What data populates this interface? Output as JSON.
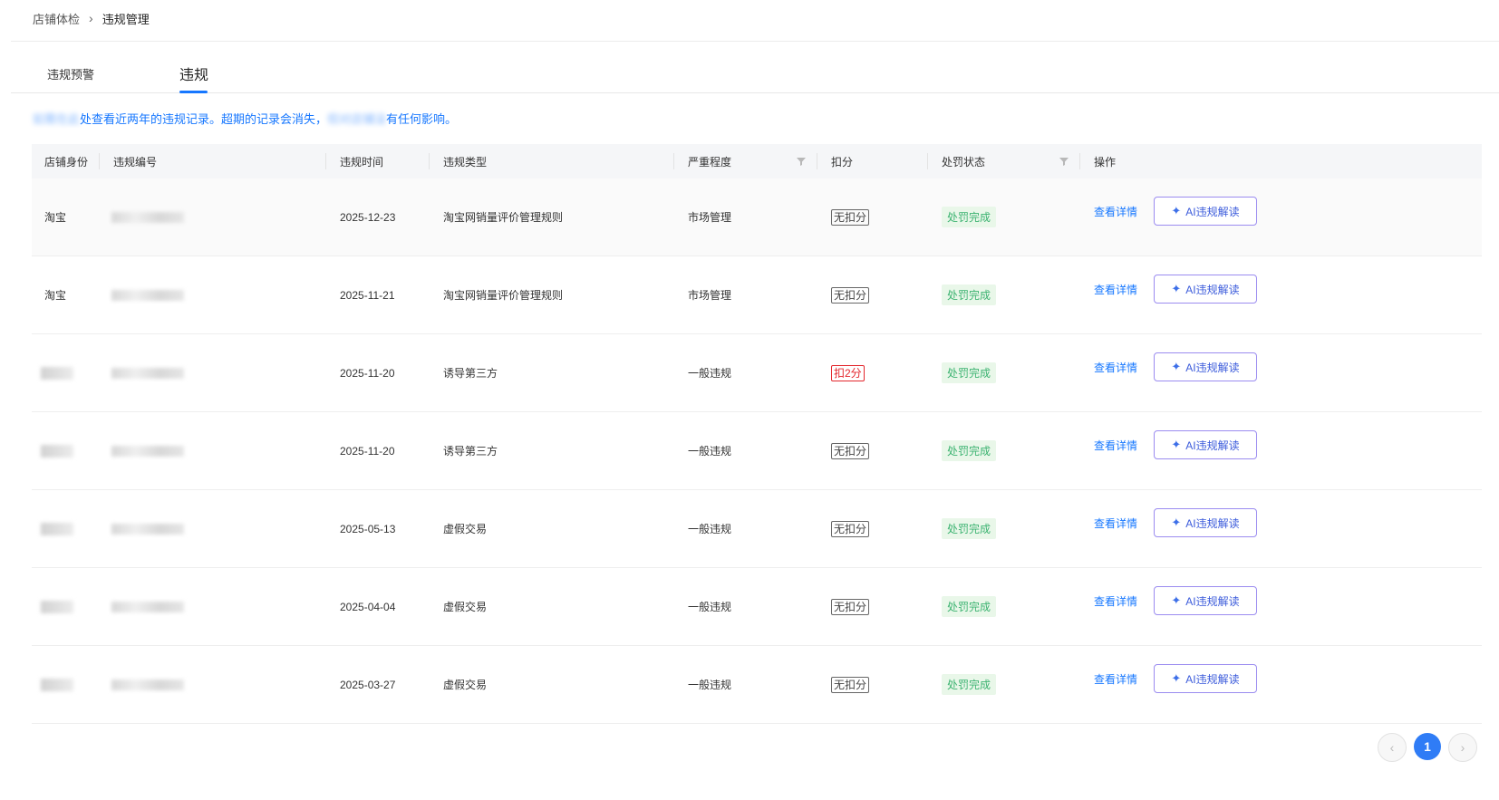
{
  "breadcrumb": {
    "parent": "店铺体检",
    "separator": "›",
    "current": "违规管理"
  },
  "tabs": {
    "warning": "违规预警",
    "violation": "违规"
  },
  "notice": {
    "text": "如需查看近两年的违规记录。超期的记录会消失，但对店铺没有任何影响。",
    "visible_text": "处查看近两年的违规记录。超期的记录会消失，",
    "visible_tail": "有任何影响。"
  },
  "table": {
    "headers": [
      "店铺身份",
      "违规编号",
      "违规时间",
      "违规类型",
      "严重程度",
      "扣分",
      "处罚状态",
      "操作"
    ],
    "rows": [
      {
        "shop": "淘宝",
        "id": "",
        "date": "2025-12-23",
        "type": "淘宝网销量评价管理规则",
        "severity": "市场管理",
        "deduct": "无扣分",
        "deduct_kind": "none",
        "status": "处罚完成",
        "detail": "查看详情",
        "ai": "AI违规解读"
      },
      {
        "shop": "淘宝",
        "id": "",
        "date": "2025-11-21",
        "type": "淘宝网销量评价管理规则",
        "severity": "市场管理",
        "deduct": "无扣分",
        "deduct_kind": "none",
        "status": "处罚完成",
        "detail": "查看详情",
        "ai": "AI违规解读"
      },
      {
        "shop": "",
        "id": "",
        "date": "2025-11-20",
        "type": "诱导第三方",
        "severity": "一般违规",
        "deduct": "扣2分",
        "deduct_kind": "deduct",
        "status": "处罚完成",
        "detail": "查看详情",
        "ai": "AI违规解读"
      },
      {
        "shop": "",
        "id": "",
        "date": "2025-11-20",
        "type": "诱导第三方",
        "severity": "一般违规",
        "deduct": "无扣分",
        "deduct_kind": "none",
        "status": "处罚完成",
        "detail": "查看详情",
        "ai": "AI违规解读"
      },
      {
        "shop": "",
        "id": "",
        "date": "2025-05-13",
        "type": "虚假交易",
        "severity": "一般违规",
        "deduct": "无扣分",
        "deduct_kind": "none",
        "status": "处罚完成",
        "detail": "查看详情",
        "ai": "AI违规解读"
      },
      {
        "shop": "",
        "id": "",
        "date": "2025-04-04",
        "type": "虚假交易",
        "severity": "一般违规",
        "deduct": "无扣分",
        "deduct_kind": "none",
        "status": "处罚完成",
        "detail": "查看详情",
        "ai": "AI违规解读"
      },
      {
        "shop": "",
        "id": "",
        "date": "2025-03-27",
        "type": "虚假交易",
        "severity": "一般违规",
        "deduct": "无扣分",
        "deduct_kind": "none",
        "status": "处罚完成",
        "detail": "查看详情",
        "ai": "AI违规解读"
      }
    ]
  },
  "pagination": {
    "prev": "‹",
    "current": "1",
    "next": "›"
  },
  "colors": {
    "accent": "#1677ff",
    "deduct": "#e3262c",
    "status_bg": "#e9f7e9",
    "status_fg": "#3cb371"
  },
  "icons": {
    "filter": "filter-icon",
    "ai": "sparkle-icon"
  }
}
